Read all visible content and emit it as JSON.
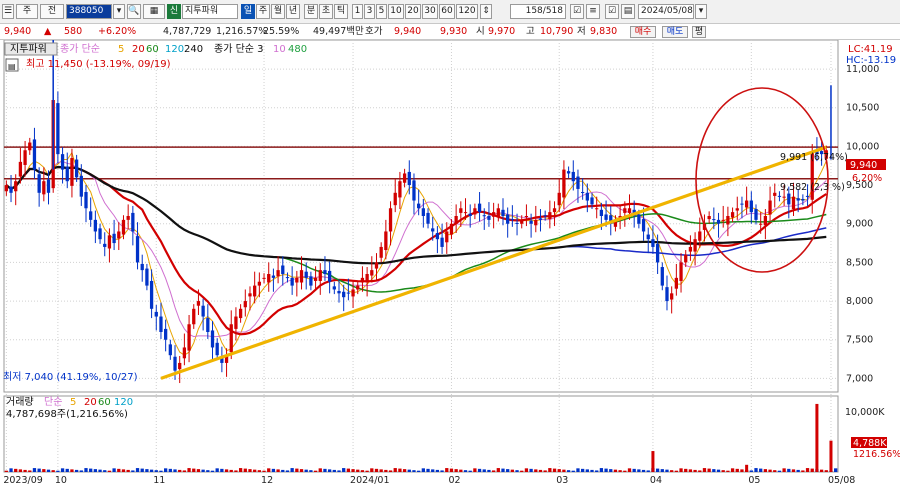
{
  "toolbar": {
    "mode_label": "주",
    "type_label": "전",
    "code_value": "388050",
    "search_icon_glyph": "🔍",
    "stock_badge": "신",
    "stock_name": "지투파워",
    "periods": [
      "일",
      "주",
      "월",
      "년",
      "분",
      "초",
      "틱"
    ],
    "active_period": "일",
    "intervals": [
      "1",
      "3",
      "5",
      "10",
      "20",
      "30",
      "60",
      "120"
    ],
    "count_label": "158/518",
    "date_value": "2024/05/08"
  },
  "quote": {
    "price": "9,940",
    "change_arrow": "▲",
    "change": "580",
    "change_pct": "+6.20%",
    "volume": "4,787,729",
    "volume_pct": "1,216.57%",
    "turnover_pct": "25.59%",
    "amount": "49,497백만",
    "ask_label": "호가",
    "ask": "9,940",
    "bid": "9,930",
    "open_label": "시",
    "open": "9,970",
    "high_label": "고",
    "high": "10,790",
    "low_label": "저",
    "low": "9,830",
    "buy_button": "매수",
    "sell_button": "매도",
    "eval_button": "평"
  },
  "legend": {
    "title": "지투파워",
    "price_ma_label": "종가 단순",
    "price_ma_periods": [
      "5",
      "20",
      "60",
      "120",
      "240"
    ],
    "price_ma_colors": [
      "#e8a400",
      "#d20000",
      "#1a8a1a",
      "#00a0c8",
      "#111111"
    ],
    "close_ma_label": "종가 단순 3",
    "close_ma_periods": [
      "10",
      "480"
    ],
    "close_ma_colors": [
      "#d070d0",
      "#20a040"
    ],
    "lc_label": "LC:41.19",
    "hc_label": "HC:-13.19",
    "high_note": "최고 11,450 (-13.19%, 09/19)",
    "low_note": "최저 7,040 (41.19%, 10/27)",
    "res1": "9,991 (6,74%)",
    "res2": "9,582 (2,3 %)",
    "price_tag": "9,940",
    "price_tag_pct": "6.20%"
  },
  "volume_legend": {
    "label": "거래량",
    "ma_label": "단순",
    "periods": [
      "5",
      "20",
      "60",
      "120"
    ],
    "colors": [
      "#e8a400",
      "#d20000",
      "#1a8a1a",
      "#00a0c8"
    ],
    "value_note": "4,787,698주(1,216.56%)",
    "tag_value": "4,788K",
    "tag_pct": "1216.56%",
    "axis_top": "10,000K"
  },
  "colors": {
    "up": "#d20000",
    "down": "#0032c8",
    "trendline": "#f0b400",
    "resistance": "#8b1a1a",
    "circle": "#cc1010"
  },
  "chart_data": {
    "type": "candlestick",
    "title": "",
    "y_ticks": [
      "11,000",
      "10,500",
      "10,000",
      "9,500",
      "9,000",
      "8,500",
      "8,000",
      "7,500",
      "7,000"
    ],
    "y_ticks_values": [
      11000,
      10500,
      10000,
      9500,
      9000,
      8500,
      8000,
      7500,
      7000
    ],
    "ylim": [
      6850,
      11350
    ],
    "x_labels": [
      "2023/09",
      "10",
      "11",
      "12",
      "2024/01",
      "02",
      "03",
      "04",
      "05",
      "05/08"
    ],
    "x_label_index": [
      0,
      11,
      32,
      55,
      74,
      95,
      118,
      138,
      159,
      176
    ],
    "n_bars": 178,
    "resistance_levels": [
      9991,
      9582
    ],
    "trendline": {
      "from_index": 33,
      "from_value": 7000,
      "to_index": 175,
      "to_value": 9990
    },
    "close": [
      9500,
      9400,
      9550,
      9800,
      9950,
      10050,
      9700,
      9400,
      9550,
      9400,
      10600,
      9900,
      9700,
      9550,
      9850,
      9600,
      9350,
      9200,
      9050,
      8900,
      8800,
      8700,
      8850,
      8750,
      8900,
      9050,
      9100,
      8900,
      8500,
      8400,
      8200,
      7900,
      7800,
      7600,
      7500,
      7300,
      7100,
      7200,
      7400,
      7700,
      7900,
      8000,
      7800,
      7600,
      7400,
      7300,
      7200,
      7300,
      7700,
      7800,
      7900,
      8000,
      8100,
      8200,
      8250,
      8300,
      8350,
      8300,
      8400,
      8350,
      8300,
      8200,
      8300,
      8400,
      8300,
      8200,
      8300,
      8400,
      8350,
      8250,
      8150,
      8100,
      8050,
      8100,
      8150,
      8200,
      8300,
      8350,
      8400,
      8500,
      8700,
      8900,
      9200,
      9400,
      9550,
      9650,
      9500,
      9300,
      9200,
      9100,
      9000,
      8900,
      8800,
      8700,
      8900,
      9000,
      9100,
      9200,
      9150,
      9100,
      9200,
      9150,
      9100,
      9050,
      9150,
      9200,
      9100,
      9000,
      9050,
      9000,
      9050,
      9100,
      9000,
      9050,
      9050,
      9100,
      9150,
      9200,
      9400,
      9700,
      9650,
      9550,
      9450,
      9400,
      9300,
      9250,
      9200,
      9100,
      9050,
      9000,
      9050,
      9100,
      9200,
      9200,
      9100,
      9000,
      8900,
      8800,
      8700,
      8500,
      8200,
      8000,
      8100,
      8300,
      8500,
      8600,
      8700,
      8800,
      8900,
      9000,
      9100,
      9050,
      9000,
      9050,
      9100,
      9150,
      9200,
      9250,
      9300,
      9150,
      9050,
      9000,
      9100,
      9300,
      9400,
      9350,
      9350,
      9250,
      9350,
      9300,
      9300,
      9350,
      9940,
      9900,
      9900,
      9950
    ],
    "volume_spikes": [
      {
        "index": 138,
        "value": 3200
      },
      {
        "index": 158,
        "value": 1100
      },
      {
        "index": 173,
        "value": 10400
      },
      {
        "index": 176,
        "value": 4788
      }
    ],
    "volume_axis_max": 11000
  }
}
